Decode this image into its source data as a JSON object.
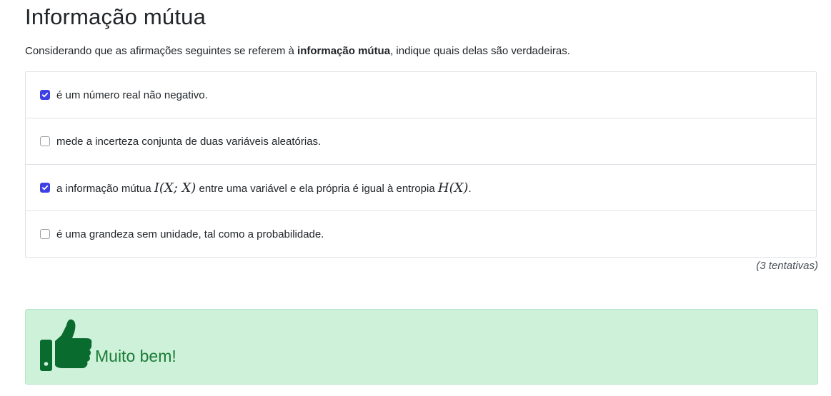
{
  "title": "Informação mútua",
  "intro": {
    "prefix": "Considerando que as afirmações seguintes se referem à ",
    "emphasis": "informação mútua",
    "suffix": ", indique quais delas são verdadeiras."
  },
  "options": [
    {
      "checked": true,
      "text": "é um número real não negativo."
    },
    {
      "checked": false,
      "text": "mede a incerteza conjunta de duas variáveis aleatórias."
    },
    {
      "checked": true,
      "text_a": "a informação mútua ",
      "math_a": "I(X; X)",
      "text_b": " entre uma variável e ela própria é igual à entropia ",
      "math_b": "H(X)",
      "text_c": "."
    },
    {
      "checked": false,
      "text": "é uma grandeza sem unidade, tal como a probabilidade."
    }
  ],
  "attempts": "(3 tentativas)",
  "feedback": {
    "icon": "thumbs-up-icon",
    "text": "Muito bem!"
  },
  "colors": {
    "checkbox": "#3f3fe6",
    "feedback_bg": "#cdf2d9",
    "feedback_fg": "#1b7a35"
  }
}
